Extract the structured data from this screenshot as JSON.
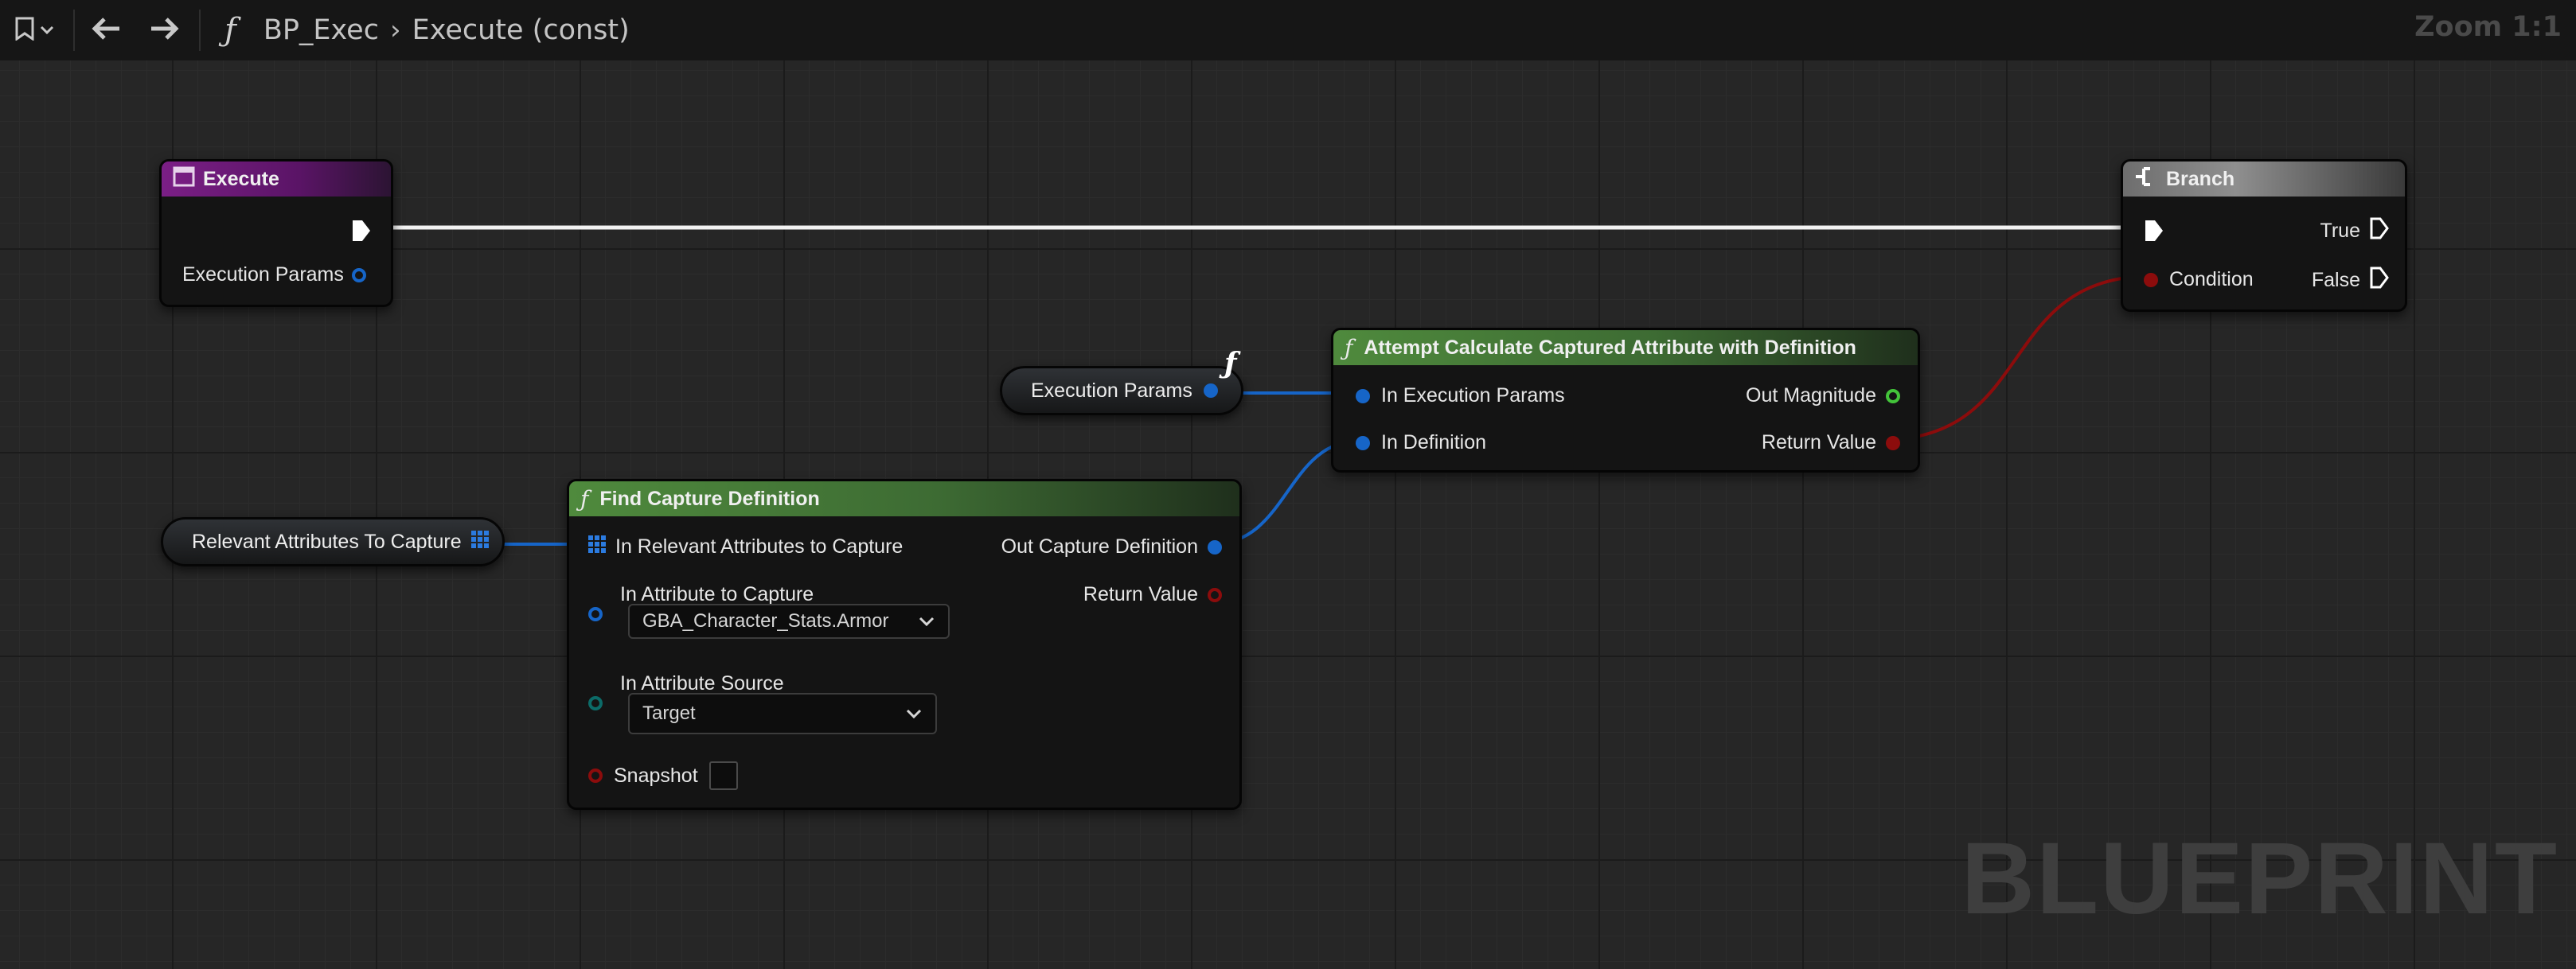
{
  "toolbar": {
    "breadcrumb": {
      "function_icon": "function-icon",
      "graph": "BP_Exec",
      "function": "Execute (const)"
    },
    "zoom": "Zoom 1:1"
  },
  "watermark": "BLUEPRINT",
  "colors": {
    "exec_wire": "#f2f2f2",
    "struct_pin": "#1665c8",
    "bool_pin": "#8c0c0c",
    "float_pin": "#43c43a",
    "enum_pin": "#0c6b68",
    "entry_header": "#7b1f86",
    "pure_function_header": "#4f8a3d",
    "branch_header": "#8f8f8f"
  },
  "nodes": {
    "execute": {
      "title": "Execute",
      "pins": {
        "params": "Execution Params"
      }
    },
    "branch": {
      "title": "Branch",
      "pins": {
        "condition": "Condition",
        "true": "True",
        "false": "False"
      }
    },
    "exec_params_getter": {
      "label": "Execution Params"
    },
    "attempt_calc": {
      "title": "Attempt Calculate Captured Attribute with Definition",
      "pins": {
        "in_exec_params": "In Execution Params",
        "in_definition": "In Definition",
        "out_magnitude": "Out Magnitude",
        "return_value": "Return Value"
      }
    },
    "relevant_attrs_getter": {
      "label": "Relevant Attributes To Capture"
    },
    "find_capture": {
      "title": "Find Capture Definition",
      "pins": {
        "in_relevant": "In Relevant Attributes to Capture",
        "in_attribute": "In Attribute to Capture",
        "in_source": "In Attribute Source",
        "snapshot": "Snapshot",
        "out_capture": "Out Capture Definition",
        "return_value": "Return Value"
      },
      "attribute_value": "GBA_Character_Stats.Armor",
      "source_value": "Target",
      "snapshot_checked": false
    }
  }
}
